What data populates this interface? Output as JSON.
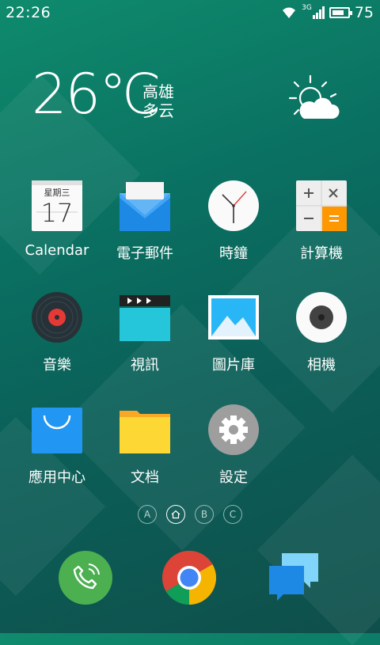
{
  "status_bar": {
    "time": "22:26",
    "network": "3G",
    "battery_text": "75",
    "battery_level": 0.75
  },
  "weather": {
    "temperature": "26℃",
    "city": "高雄",
    "condition": "多云",
    "icon": "sun-cloud-icon"
  },
  "apps": [
    {
      "label": "Calendar",
      "icon": "calendar-icon",
      "calendar_weekday": "星期三",
      "calendar_day": "17"
    },
    {
      "label": "電子郵件",
      "icon": "mail-icon"
    },
    {
      "label": "時鐘",
      "icon": "clock-icon"
    },
    {
      "label": "計算機",
      "icon": "calculator-icon"
    },
    {
      "label": "音樂",
      "icon": "music-icon"
    },
    {
      "label": "視訊",
      "icon": "video-icon"
    },
    {
      "label": "圖片庫",
      "icon": "gallery-icon"
    },
    {
      "label": "相機",
      "icon": "camera-icon"
    },
    {
      "label": "應用中心",
      "icon": "app-store-icon"
    },
    {
      "label": "文档",
      "icon": "folder-icon"
    },
    {
      "label": "設定",
      "icon": "settings-icon"
    }
  ],
  "page_indicator": {
    "pages": [
      "A",
      "home",
      "B",
      "C"
    ],
    "active_index": 1
  },
  "dock": [
    {
      "name": "phone",
      "icon": "phone-icon",
      "color": "#4caf50"
    },
    {
      "name": "chrome",
      "icon": "chrome-icon",
      "color": "#4285f4"
    },
    {
      "name": "messages",
      "icon": "messages-icon",
      "color": "#1e88e5"
    }
  ]
}
